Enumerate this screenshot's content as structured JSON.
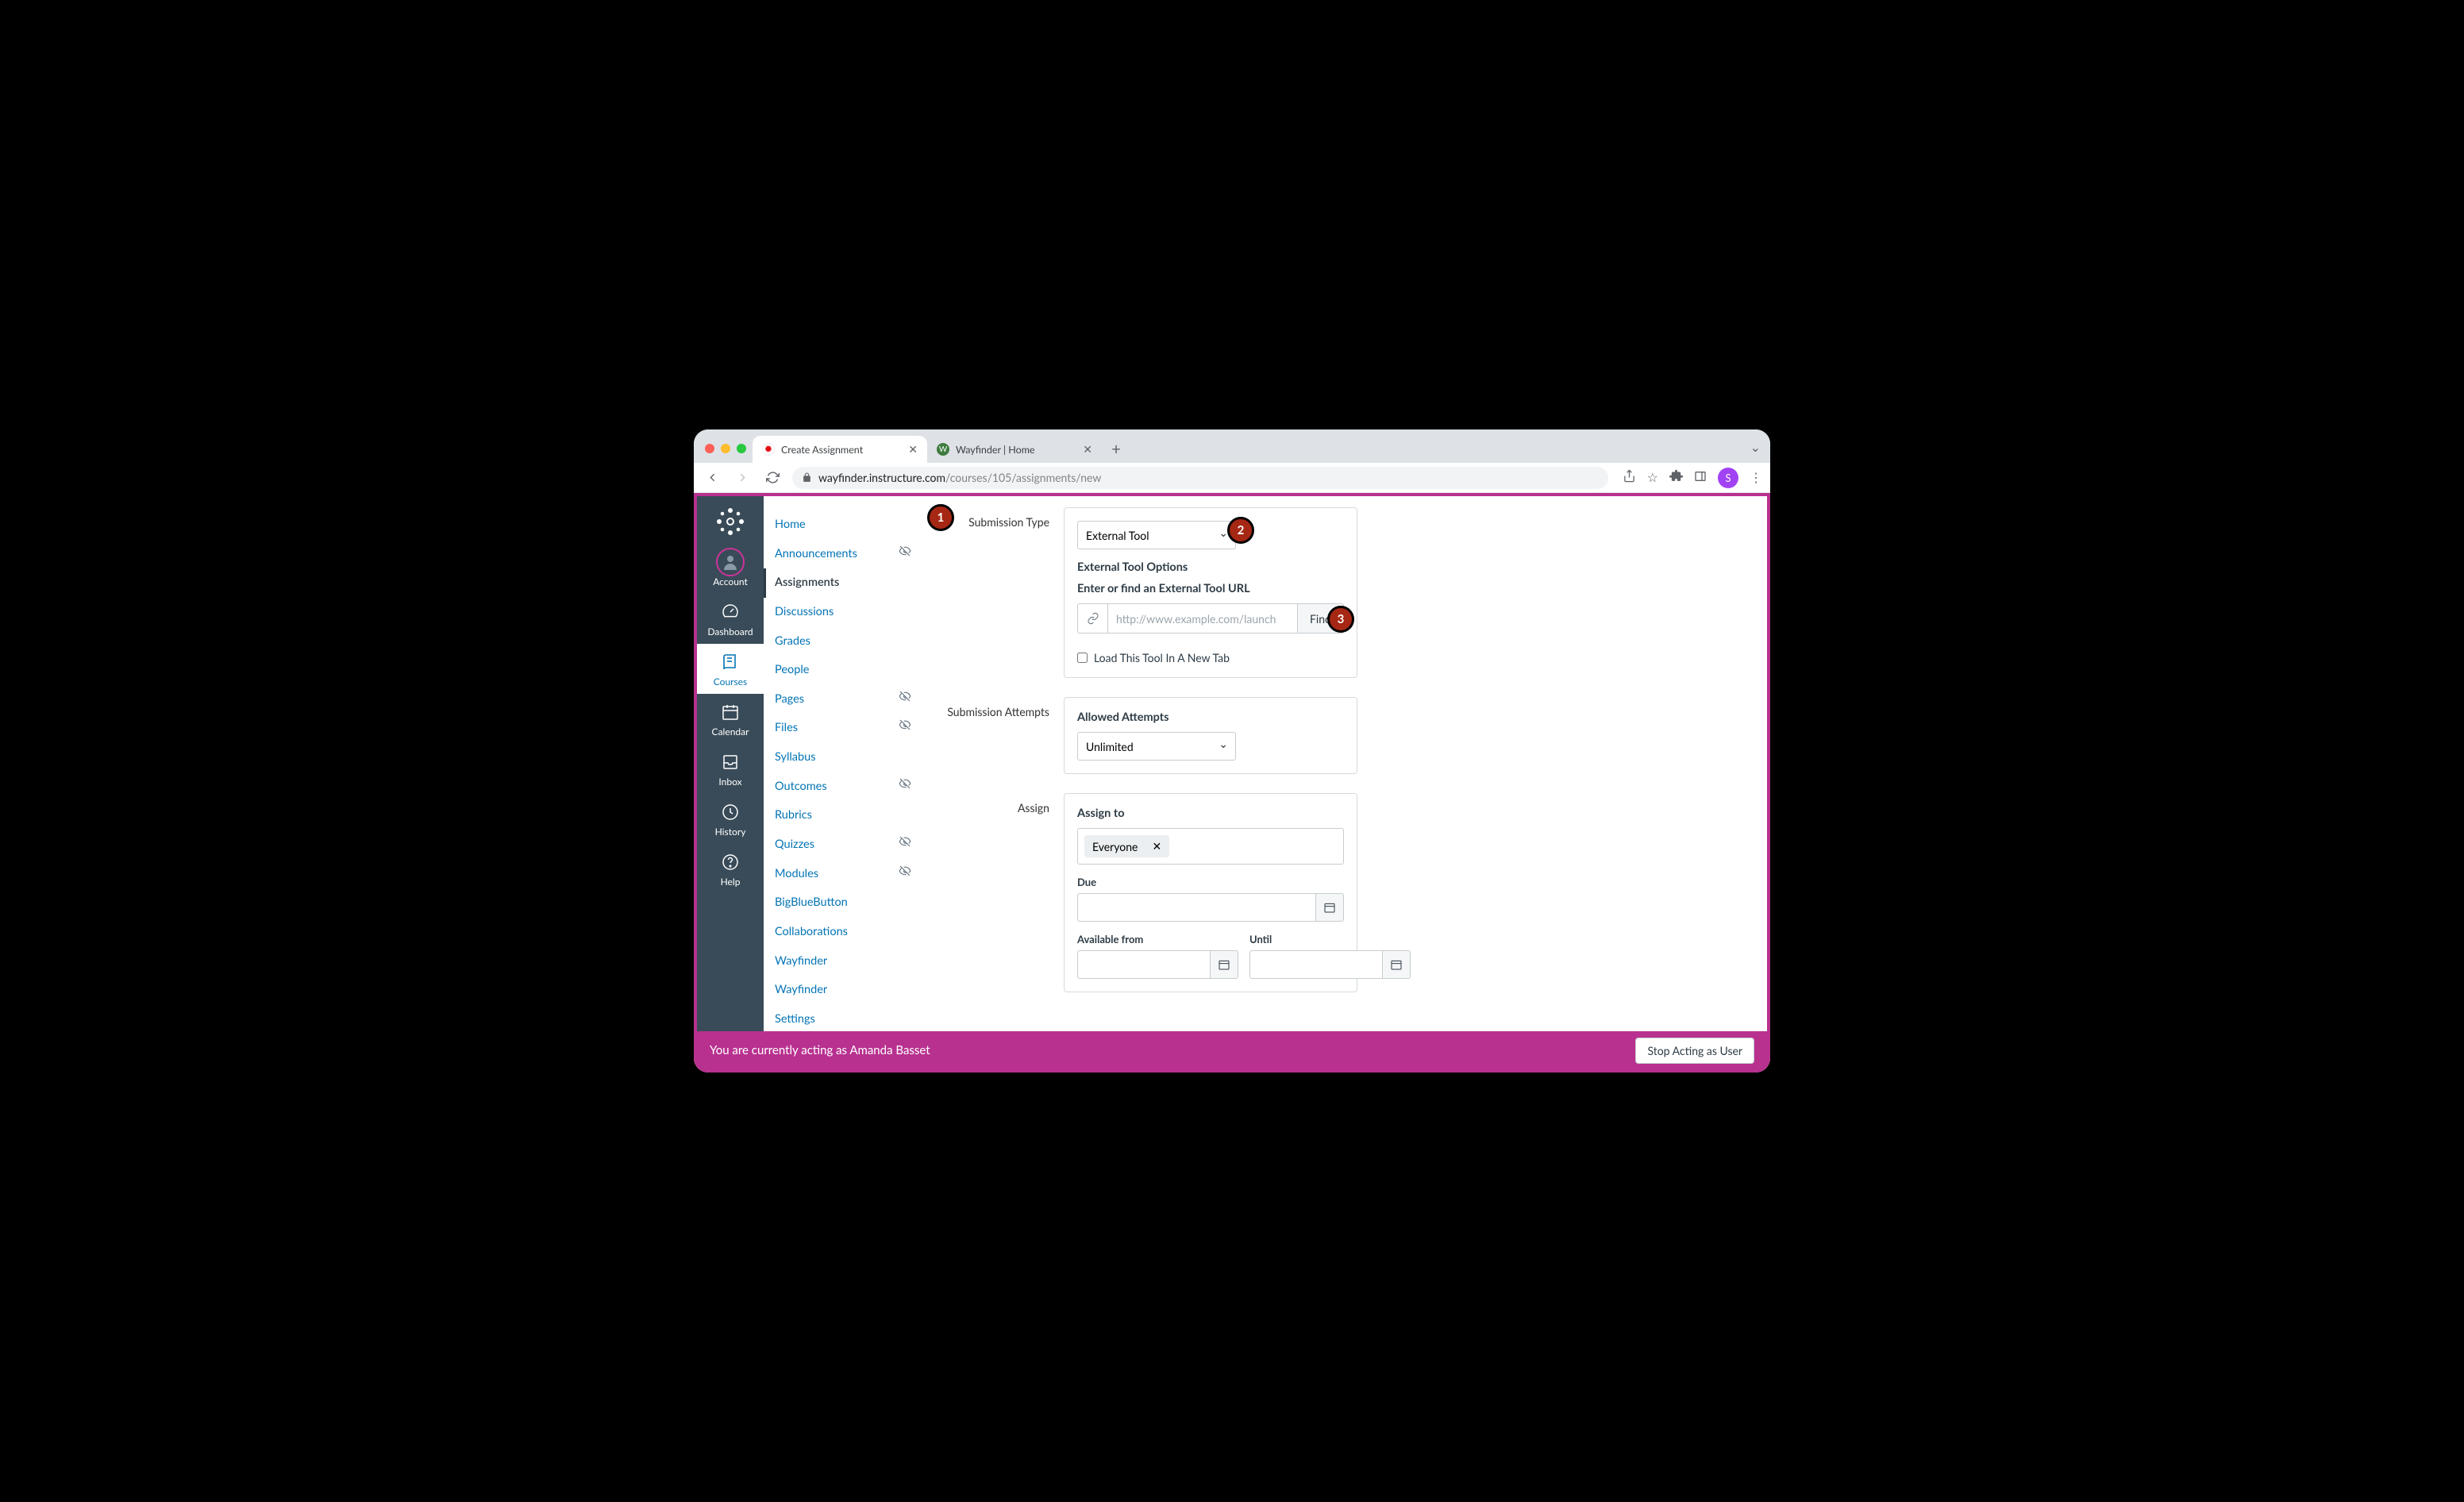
{
  "browser": {
    "tabs": [
      {
        "title": "Create Assignment",
        "active": true,
        "favicon": "C"
      },
      {
        "title": "Wayfinder | Home",
        "active": false,
        "favicon": "W"
      }
    ],
    "url_host": "wayfinder.instructure.com",
    "url_path": "/courses/105/assignments/new",
    "profile_initial": "S"
  },
  "global_nav": [
    {
      "label": "Account",
      "icon": "avatar"
    },
    {
      "label": "Dashboard",
      "icon": "dashboard"
    },
    {
      "label": "Courses",
      "icon": "courses",
      "active": true
    },
    {
      "label": "Calendar",
      "icon": "calendar"
    },
    {
      "label": "Inbox",
      "icon": "inbox"
    },
    {
      "label": "History",
      "icon": "history"
    },
    {
      "label": "Help",
      "icon": "help"
    }
  ],
  "course_nav": [
    {
      "label": "Home"
    },
    {
      "label": "Announcements",
      "hidden": true
    },
    {
      "label": "Assignments",
      "active": true
    },
    {
      "label": "Discussions"
    },
    {
      "label": "Grades"
    },
    {
      "label": "People"
    },
    {
      "label": "Pages",
      "hidden": true
    },
    {
      "label": "Files",
      "hidden": true
    },
    {
      "label": "Syllabus"
    },
    {
      "label": "Outcomes",
      "hidden": true
    },
    {
      "label": "Rubrics"
    },
    {
      "label": "Quizzes",
      "hidden": true
    },
    {
      "label": "Modules",
      "hidden": true
    },
    {
      "label": "BigBlueButton"
    },
    {
      "label": "Collaborations"
    },
    {
      "label": "Wayfinder"
    },
    {
      "label": "Wayfinder"
    },
    {
      "label": "Settings"
    }
  ],
  "form": {
    "submission_type_label": "Submission Type",
    "submission_type_value": "External Tool",
    "ext_options_heading": "External Tool Options",
    "ext_url_heading": "Enter or find an External Tool URL",
    "ext_url_placeholder": "http://www.example.com/launch",
    "find_label": "Find",
    "load_new_tab_label": "Load This Tool In A New Tab",
    "attempts_label": "Submission Attempts",
    "allowed_attempts_heading": "Allowed Attempts",
    "allowed_attempts_value": "Unlimited",
    "assign_label": "Assign",
    "assign_to_heading": "Assign to",
    "assign_to_value": "Everyone",
    "due_label": "Due",
    "available_from_label": "Available from",
    "until_label": "Until"
  },
  "masquerade": {
    "text": "You are currently acting as Amanda Basset",
    "stop_label": "Stop Acting as User"
  },
  "annotations": {
    "a1": "1",
    "a2": "2",
    "a3": "3"
  }
}
